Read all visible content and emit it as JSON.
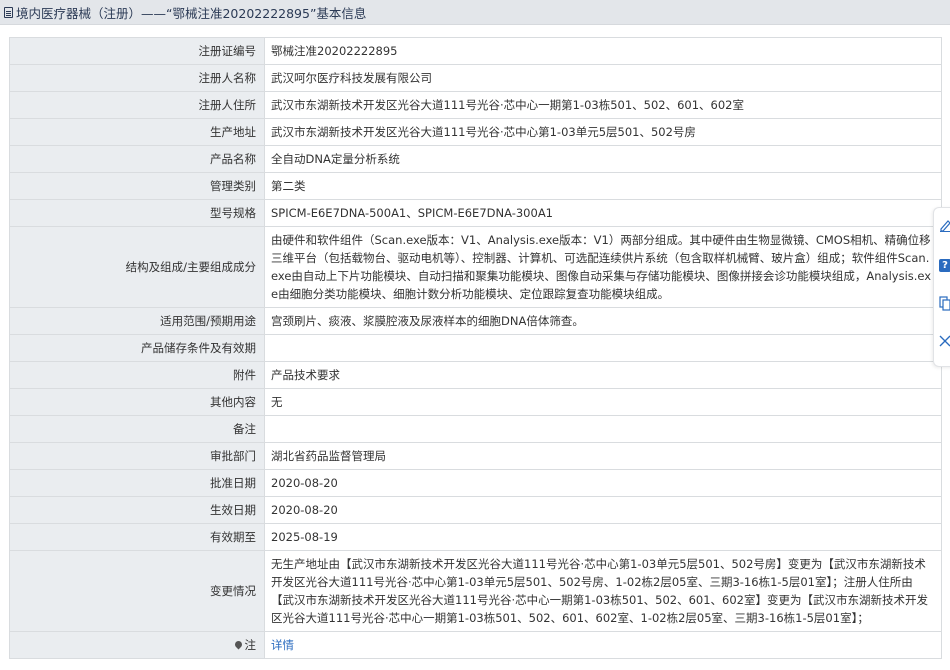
{
  "header": {
    "title": "境内医疗器械（注册）——“鄂械注准20202222895”基本信息"
  },
  "rows": [
    {
      "label": "注册证编号",
      "value": "鄂械注准20202222895"
    },
    {
      "label": "注册人名称",
      "value": "武汉呵尔医疗科技发展有限公司"
    },
    {
      "label": "注册人住所",
      "value": "武汉市东湖新技术开发区光谷大道111号光谷·芯中心一期第1-03栋501、502、601、602室"
    },
    {
      "label": "生产地址",
      "value": "武汉市东湖新技术开发区光谷大道111号光谷·芯中心第1-03单元5层501、502号房"
    },
    {
      "label": "产品名称",
      "value": "全自动DNA定量分析系统"
    },
    {
      "label": "管理类别",
      "value": "第二类"
    },
    {
      "label": "型号规格",
      "value": "SPICM-E6E7DNA-500A1、SPICM-E6E7DNA-300A1"
    },
    {
      "label": "结构及组成/主要组成成分",
      "value": "由硬件和软件组件（Scan.exe版本：V1、Analysis.exe版本：V1）两部分组成。其中硬件由生物显微镜、CMOS相机、精确位移三维平台（包括载物台、驱动电机等）、控制器、计算机、可选配连续供片系统（包含取样机械臂、玻片盒）组成；软件组件Scan.exe由自动上下片功能模块、自动扫描和聚集功能模块、图像自动采集与存储功能模块、图像拼接会诊功能模块组成，Analysis.exe由细胞分类功能模块、细胞计数分析功能模块、定位跟踪复查功能模块组成。"
    },
    {
      "label": "适用范围/预期用途",
      "value": "宫颈刷片、痰液、浆膜腔液及尿液样本的细胞DNA倍体筛查。"
    },
    {
      "label": "产品储存条件及有效期",
      "value": ""
    },
    {
      "label": "附件",
      "value": "产品技术要求"
    },
    {
      "label": "其他内容",
      "value": "无"
    },
    {
      "label": "备注",
      "value": ""
    },
    {
      "label": "审批部门",
      "value": "湖北省药品监督管理局"
    },
    {
      "label": "批准日期",
      "value": "2020-08-20"
    },
    {
      "label": "生效日期",
      "value": "2020-08-20"
    },
    {
      "label": "有效期至",
      "value": "2025-08-19"
    },
    {
      "label": "变更情况",
      "value": "无生产地址由【武汉市东湖新技术开发区光谷大道111号光谷·芯中心第1-03单元5层501、502号房】变更为【武汉市东湖新技术开发区光谷大道111号光谷·芯中心第1-03单元5层501、502号房、1-02栋2层05室、三期3-16栋1-5层01室】；注册人住所由【武汉市东湖新技术开发区光谷大道111号光谷·芯中心一期第1-03栋501、502、601、602室】变更为【武汉市东湖新技术开发区光谷大道111号光谷·芯中心一期第1-03栋501、502、601、602室、1-02栋2层05室、三期3-16栋1-5层01室】；"
    }
  ],
  "note_row": {
    "label": "注",
    "link": "详情"
  },
  "side_toolbar": {
    "icons": [
      "edit-icon",
      "help-icon",
      "copy-icon",
      "close-icon"
    ]
  }
}
